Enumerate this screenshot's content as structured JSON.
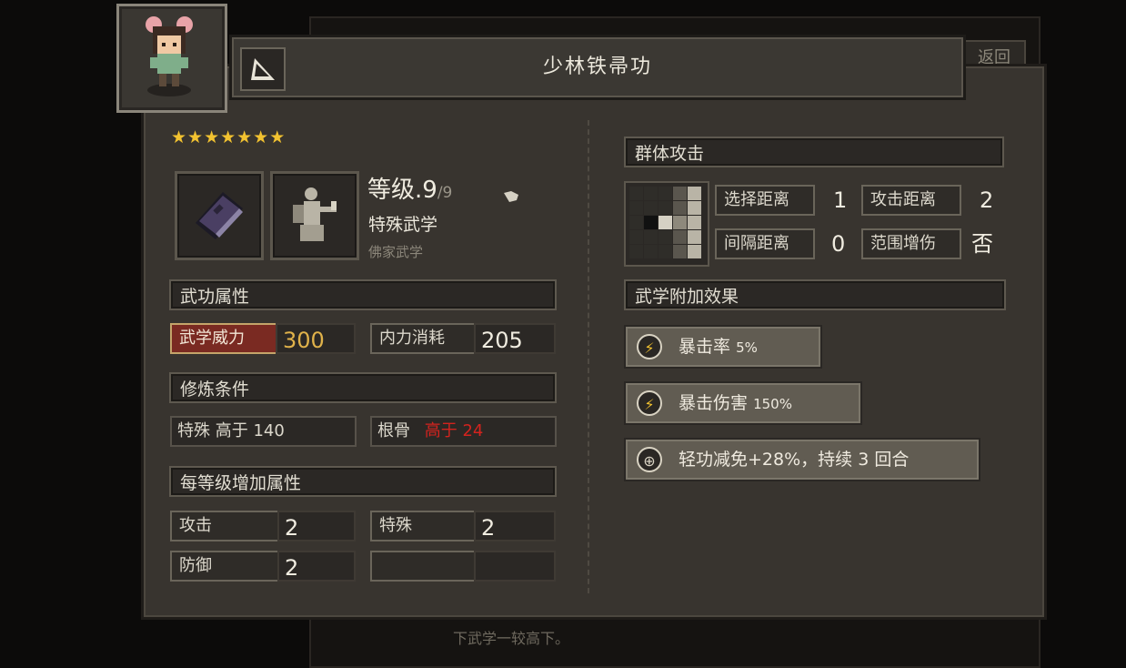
{
  "background": {
    "return_label": "返回",
    "footer_text": "下武学一较高下。"
  },
  "skill": {
    "title": "少林铁帚功",
    "stars": "★★★★★★★",
    "star_count": 7,
    "level_prefix": "等级",
    "level_value": ".9",
    "level_max": "/9",
    "type": "特殊武学",
    "school": "佛家武学"
  },
  "attributes": {
    "header": "武功属性",
    "power_label": "武学威力",
    "power_value": "300",
    "mp_label": "内力消耗",
    "mp_value": "205"
  },
  "requirements": {
    "header": "修炼条件",
    "req1": "特殊 高于 140",
    "req2_label": "根骨",
    "req2_value": "高于 24"
  },
  "per_level": {
    "header": "每等级增加属性",
    "rows": [
      {
        "label": "攻击",
        "value": "2"
      },
      {
        "label": "特殊",
        "value": "2"
      },
      {
        "label": "防御",
        "value": "2"
      },
      {
        "label": "",
        "value": ""
      }
    ]
  },
  "targeting": {
    "header": "群体攻击",
    "select_range_label": "选择距离",
    "select_range_value": "1",
    "attack_range_label": "攻击距离",
    "attack_range_value": "2",
    "interval_label": "间隔距离",
    "interval_value": "0",
    "range_boost_label": "范围增伤",
    "range_boost_value": "否"
  },
  "effects": {
    "header": "武学附加效果",
    "items": [
      {
        "name": "暴击率",
        "value": "5%",
        "icon": "lightning-icon"
      },
      {
        "name": "暴击伤害",
        "value": "150%",
        "icon": "lightning-icon"
      },
      {
        "name": "轻功减免+28%，持续 3 回合",
        "value": "",
        "icon": "target-icon"
      }
    ]
  },
  "colors": {
    "accent_gold": "#e0b24a",
    "requirement_unmet": "#d3231e",
    "star": "#f2c230"
  }
}
